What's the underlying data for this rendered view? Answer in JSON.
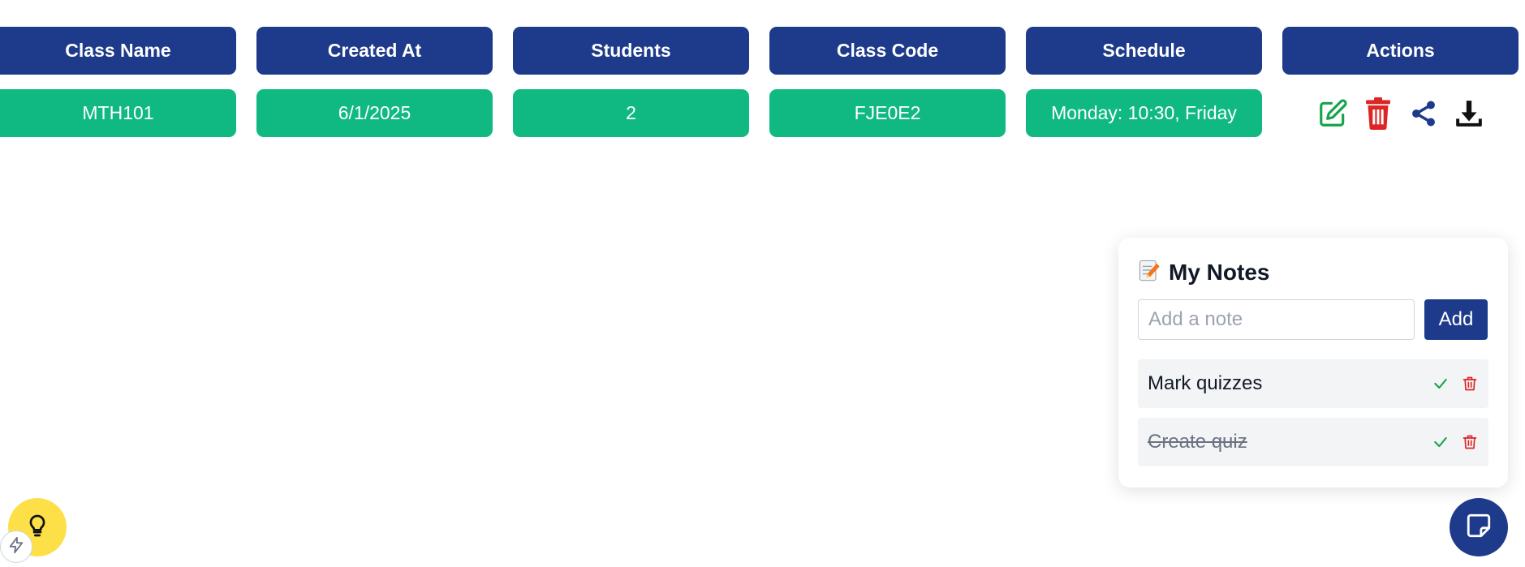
{
  "table": {
    "headers": [
      "Class Name",
      "Created At",
      "Students",
      "Class Code",
      "Schedule",
      "Actions"
    ],
    "row": {
      "class_name": "MTH101",
      "created_at": "6/1/2025",
      "students": "2",
      "class_code": "FJE0E2",
      "schedule": "Monday: 10:30, Friday"
    },
    "action_icons": [
      "edit-icon",
      "trash-icon",
      "share-icon",
      "download-icon"
    ]
  },
  "notes": {
    "title": "My Notes",
    "title_icon": "memo-icon",
    "input_placeholder": "Add a note",
    "add_label": "Add",
    "items": [
      {
        "text": "Mark quizzes",
        "done": false
      },
      {
        "text": "Create quiz",
        "done": true
      }
    ]
  },
  "floating": {
    "notes_button_icon": "sticky-note-icon",
    "tip_button_icon": "lightbulb-icon",
    "badge_icon": "bolt-icon"
  },
  "colors": {
    "header_bg": "#1e3a8a",
    "cell_bg": "#10b981",
    "edit": "#16a34a",
    "delete": "#dc2626",
    "share": "#1e3a8a",
    "tip": "#fde047"
  }
}
